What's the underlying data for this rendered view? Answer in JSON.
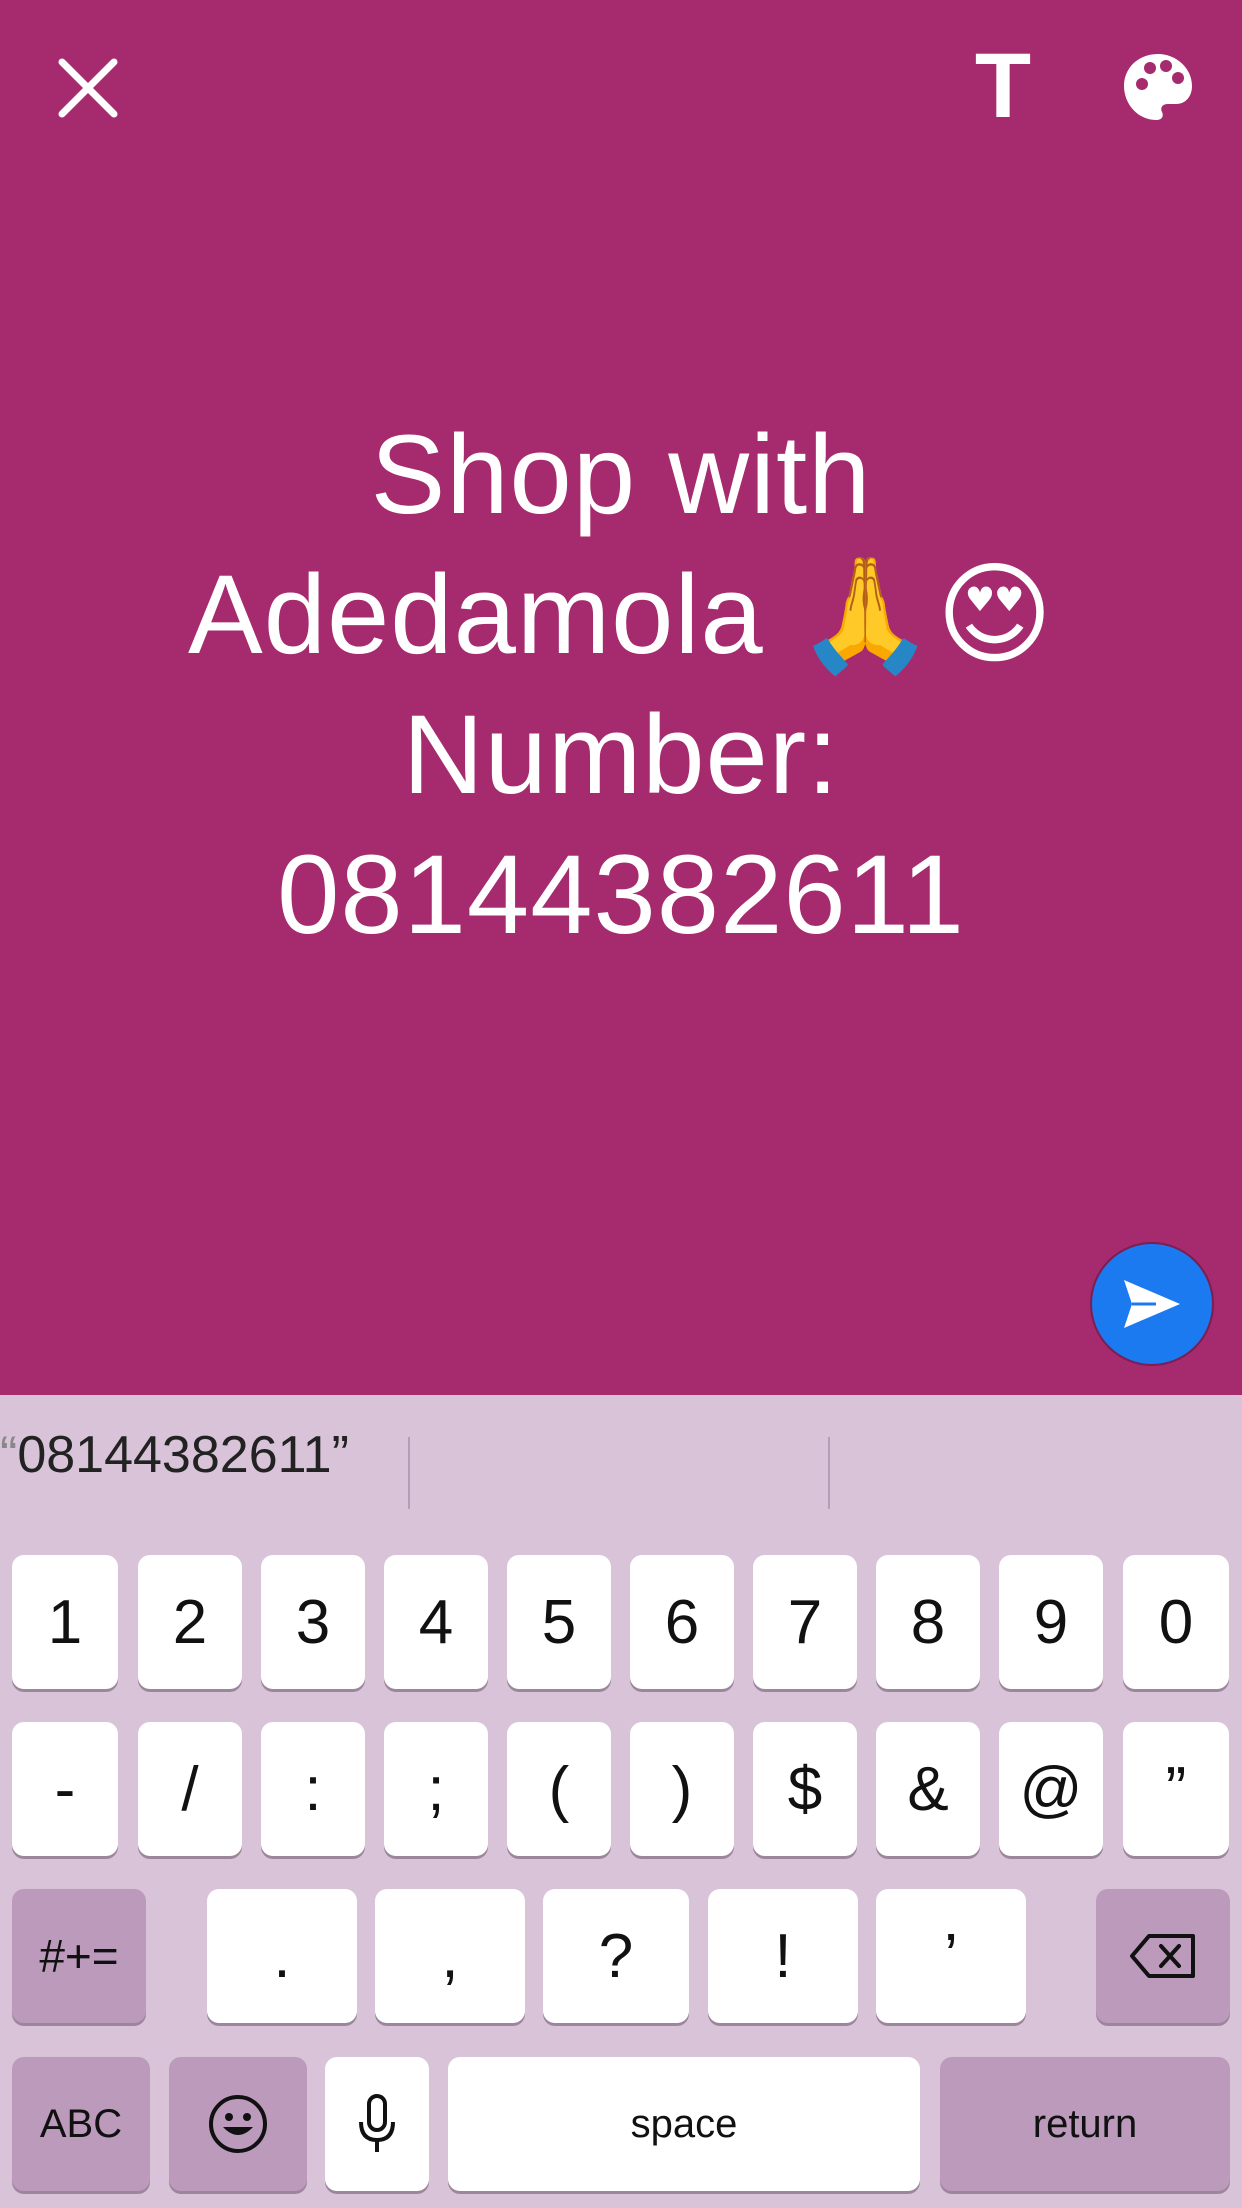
{
  "composer": {
    "background": "#a52a6e",
    "text_lines": [
      "Shop with",
      "Adedamola",
      "Number:",
      "08144382611"
    ],
    "emojis": [
      "🙏",
      "😍"
    ],
    "close_icon": "close-icon",
    "text_style_label": "T",
    "palette_icon": "palette-icon",
    "send_icon": "send-icon",
    "send_color": "#1b7af0"
  },
  "keyboard": {
    "suggestion": {
      "open_quote": "“",
      "text": "08144382611",
      "close_quote": "”"
    },
    "row1": [
      "1",
      "2",
      "3",
      "4",
      "5",
      "6",
      "7",
      "8",
      "9",
      "0"
    ],
    "row2": [
      "-",
      "/",
      ":",
      ";",
      "(",
      ")",
      "$",
      "&",
      "@",
      "”"
    ],
    "row3_shift_label": "#+=",
    "row3": [
      ".",
      ",",
      "?",
      "!",
      "’"
    ],
    "delete_icon": "backspace-icon",
    "abc_label": "ABC",
    "emoji_icon": "emoji-icon",
    "mic_icon": "microphone-icon",
    "space_label": "space",
    "return_label": "return"
  }
}
